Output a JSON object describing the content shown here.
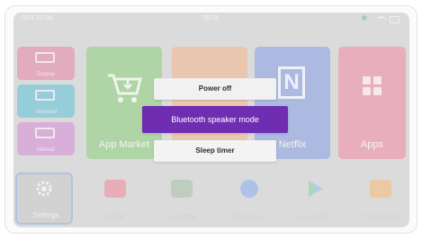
{
  "status_bar": {
    "date": "2021-01-06",
    "time": "05:25"
  },
  "left_tiles": [
    {
      "label": "Display",
      "icon": "display-sound-icon"
    },
    {
      "label": "Unsound",
      "icon": "speaker-mute-icon"
    },
    {
      "label": "Manual",
      "icon": "book-icon"
    }
  ],
  "big_tiles": [
    {
      "label": "App Market",
      "icon": "cart-download-icon",
      "color": "#a9d19f"
    },
    {
      "label": "",
      "icon": "",
      "color": "#e8c2a7"
    },
    {
      "label": "Netflix",
      "icon": "netflix-icon",
      "color": "#a5b4de"
    },
    {
      "label": "Apps",
      "icon": "apps-grid-icon",
      "color": "#e8a8b6"
    }
  ],
  "dock": [
    {
      "label": "Settings",
      "icon": "gear-icon"
    },
    {
      "label": "HDMI",
      "icon": "hdmi-icon"
    },
    {
      "label": "LocalMM",
      "icon": "folder-image-icon"
    },
    {
      "label": "MX Player",
      "icon": "play-icon"
    },
    {
      "label": "Google Pla...",
      "icon": "google-play-icon"
    },
    {
      "label": "CZ File Ma",
      "icon": "file-manager-icon"
    }
  ],
  "popup_menu": {
    "items": [
      "Power off",
      "Bluetooth speaker mode",
      "Sleep timer"
    ],
    "selected": "Bluetooth speaker mode",
    "selected_color": "#6f2db2"
  }
}
